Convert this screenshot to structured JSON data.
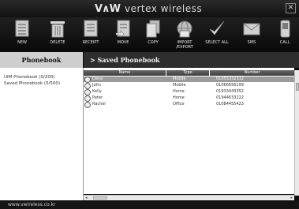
{
  "app": {
    "logo_mark": "V∧W",
    "logo_text": "vertex wireless",
    "close_symbol": "✕"
  },
  "toolbar": [
    {
      "label": "NEW",
      "icon": "new-icon"
    },
    {
      "label": "DELETE",
      "icon": "trash-icon"
    },
    {
      "label": "RECEIPT",
      "icon": "receipt-icon"
    },
    {
      "label": "MOVE",
      "icon": "move-icon"
    },
    {
      "label": "COPY",
      "icon": "copy-icon"
    },
    {
      "label": "IMPORT\n/EXPORT",
      "icon": "import-export-icon"
    },
    {
      "label": "SELECT ALL",
      "icon": "checkmark-icon"
    },
    {
      "label": "SMS",
      "icon": "envelope-icon"
    },
    {
      "label": "CALL",
      "icon": "phone-icon"
    }
  ],
  "sidebar": {
    "title": "Phonebook",
    "items": [
      {
        "label": "UIM Phonebook (0/200)"
      },
      {
        "label": "Saved Phonebook (5/500)"
      }
    ]
  },
  "main": {
    "title": "> Saved Phonebook",
    "columns": [
      "Name",
      "Type",
      "Number"
    ],
    "rows": [
      {
        "name": "Dana",
        "type": "Mobile",
        "number": "01055332312",
        "selected": true
      },
      {
        "name": "John",
        "type": "Mobile",
        "number": "01066656199",
        "selected": false
      },
      {
        "name": "Kelly",
        "type": "Home",
        "number": "01933443352",
        "selected": false
      },
      {
        "name": "Peter",
        "type": "Home",
        "number": "01944633222",
        "selected": false
      },
      {
        "name": "Rachel",
        "type": "Office",
        "number": "01084455423",
        "selected": false
      }
    ]
  },
  "footer": {
    "url": "www.vwireless.co.kr"
  },
  "colors": {
    "selected_row": "#9b9b9b",
    "header_bg": "#2e2e2e",
    "sidebar_head": "#cfcfcf"
  }
}
